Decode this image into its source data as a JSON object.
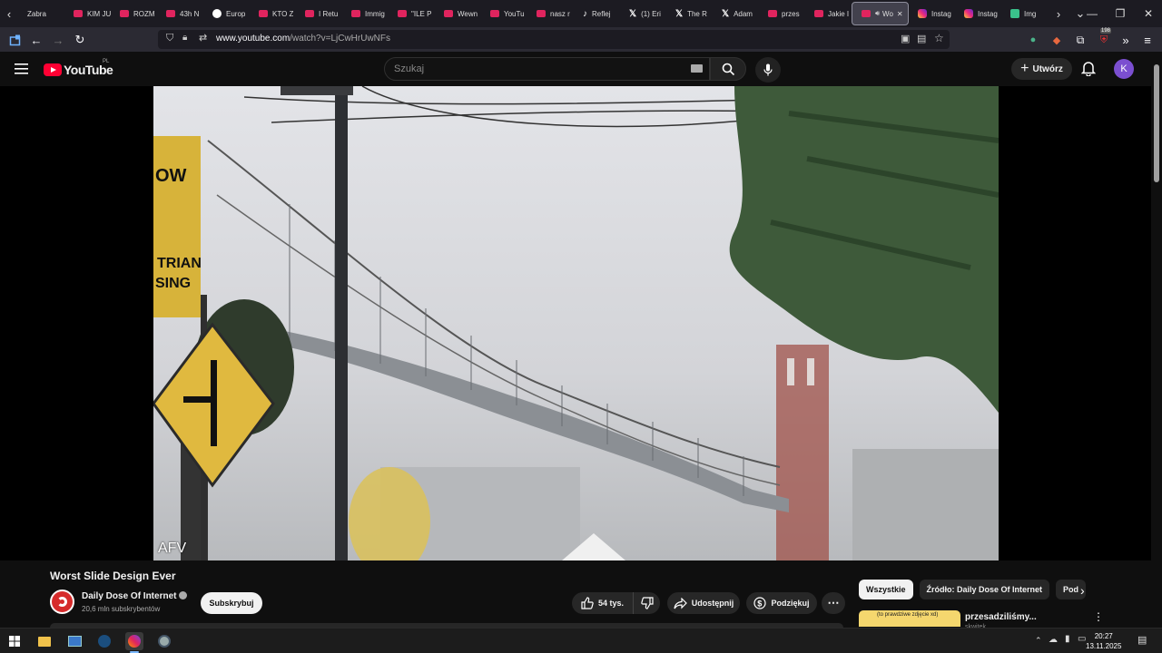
{
  "browser": {
    "tabs": [
      {
        "label": "Zabra",
        "icon": "none"
      },
      {
        "label": "KIM JU",
        "icon": "yt"
      },
      {
        "label": "ROZM",
        "icon": "yt"
      },
      {
        "label": "43h N",
        "icon": "yt"
      },
      {
        "label": "Europ",
        "icon": "eu"
      },
      {
        "label": "KTO Z",
        "icon": "yt"
      },
      {
        "label": "I Retu",
        "icon": "yt"
      },
      {
        "label": "Immig",
        "icon": "yt"
      },
      {
        "label": "\"ILE P",
        "icon": "yt"
      },
      {
        "label": "Wewn",
        "icon": "yt"
      },
      {
        "label": "YouTu",
        "icon": "yt"
      },
      {
        "label": "nasz r",
        "icon": "yt"
      },
      {
        "label": "Reflej",
        "icon": "tiktok"
      },
      {
        "label": "(1) Eri",
        "icon": "x"
      },
      {
        "label": "The R",
        "icon": "x"
      },
      {
        "label": "Adam",
        "icon": "x"
      },
      {
        "label": "przes",
        "icon": "yt"
      },
      {
        "label": "Jakie I",
        "icon": "yt"
      },
      {
        "label": "Wo",
        "icon": "yt",
        "active": true
      },
      {
        "label": "Instag",
        "icon": "ig"
      },
      {
        "label": "Instag",
        "icon": "ig"
      },
      {
        "label": "Img",
        "icon": "img"
      }
    ],
    "url_host": "www.youtube.com",
    "url_path": "/watch?v=LjCwHrUwNFs",
    "extension_badge": "198"
  },
  "youtube": {
    "logo_text": "YouTube",
    "region": "PL",
    "search_placeholder": "Szukaj",
    "create_label": "Utwórz",
    "avatar_letter": "K"
  },
  "video": {
    "watermark": "AFV",
    "title": "Worst Slide Design Ever",
    "channel_name": "Daily Dose Of Internet",
    "subscribers": "20,6 mln subskrybentów",
    "subscribe_label": "Subskrybuj",
    "likes": "54 tys.",
    "share_label": "Udostępnij",
    "thanks_label": "Podziękuj"
  },
  "sidebar": {
    "chips": [
      "Wszystkie",
      "Źródło: Daily Dose Of Internet",
      "Pod"
    ],
    "rec_title": "przesadziliśmy...",
    "rec_channel": "skwitek",
    "rec_thumb_text": "(to prawdziwe zdjęcie xd)"
  },
  "taskbar": {
    "time": "20:27",
    "date": "13.11.2025"
  },
  "colors": {
    "yt_red": "#ff0033",
    "bg": "#0f0f0f",
    "avatar": "#7b4fd0"
  }
}
